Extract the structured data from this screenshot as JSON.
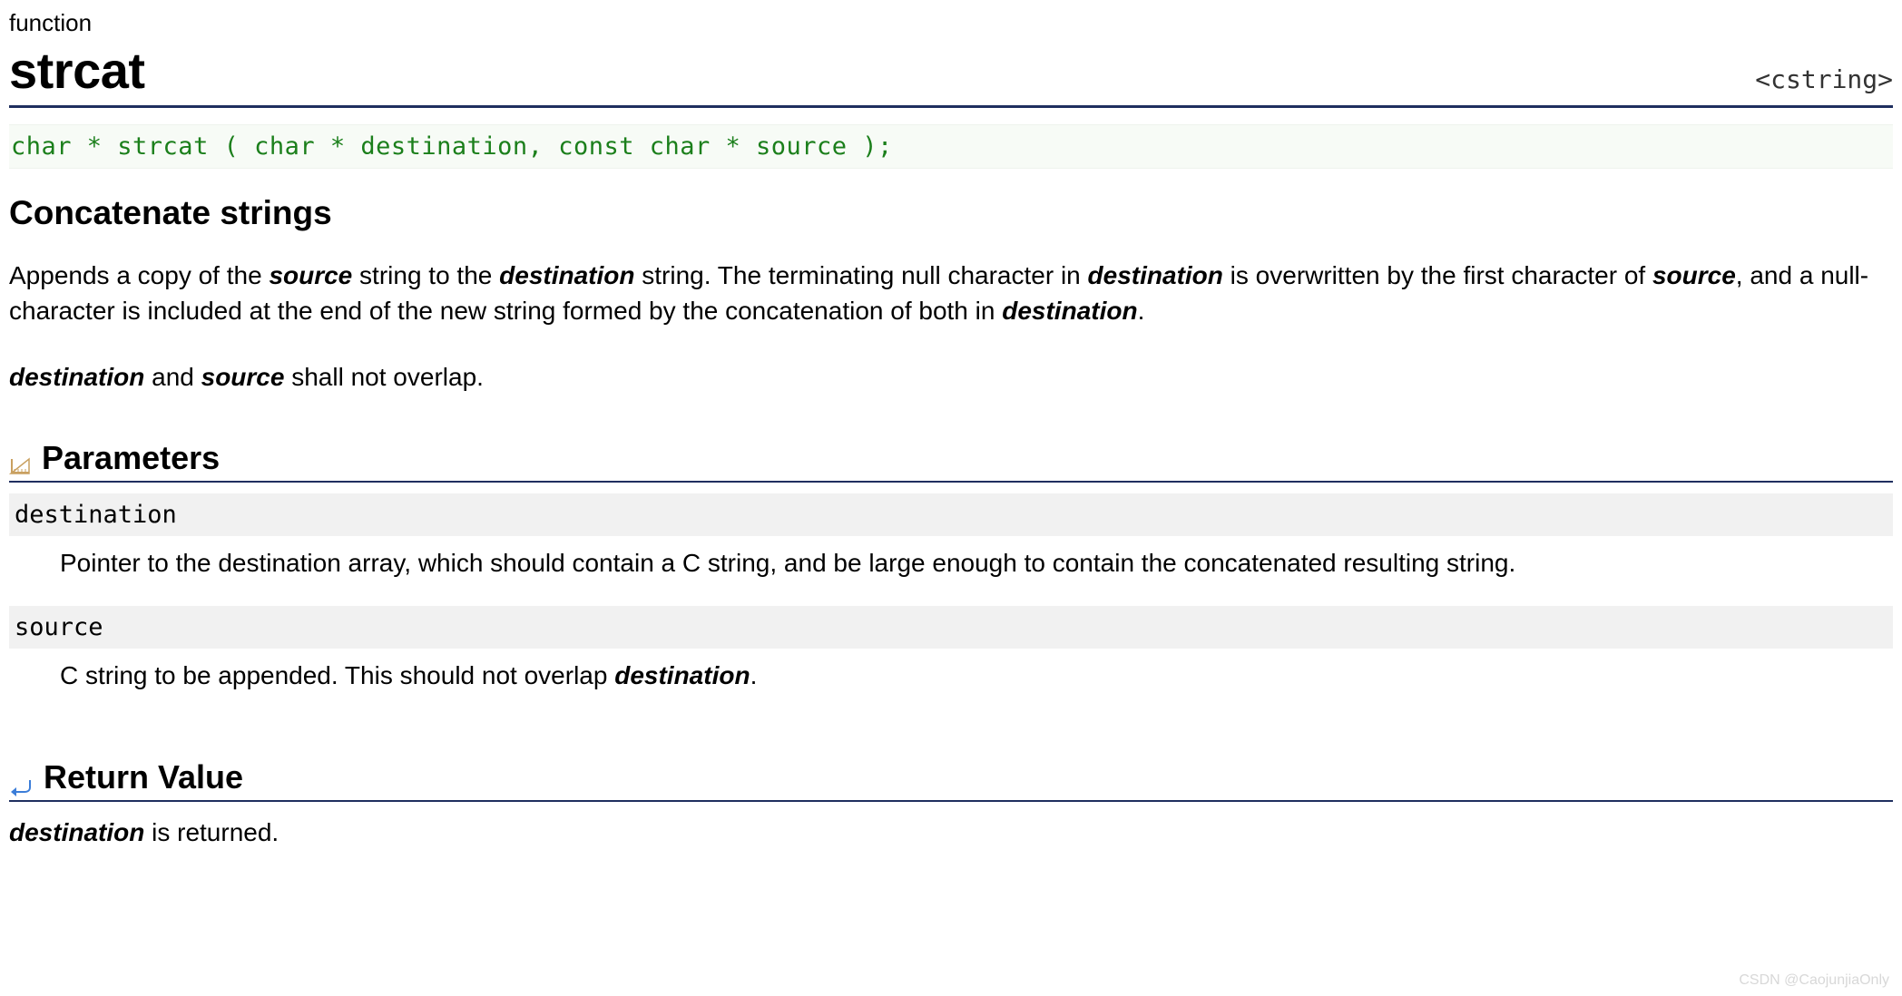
{
  "header": {
    "category": "function",
    "title": "strcat",
    "include": "<cstring>"
  },
  "signature": "char * strcat ( char * destination, const char * source );",
  "summary_heading": "Concatenate strings",
  "description": {
    "p1_parts": [
      {
        "t": "Appends a copy of the ",
        "e": false
      },
      {
        "t": "source",
        "e": true
      },
      {
        "t": " string to the ",
        "e": false
      },
      {
        "t": "destination",
        "e": true
      },
      {
        "t": " string. The terminating null character in ",
        "e": false
      },
      {
        "t": "destination",
        "e": true
      },
      {
        "t": " is overwritten by the first character of ",
        "e": false
      },
      {
        "t": "source",
        "e": true
      },
      {
        "t": ", and a null-character is included at the end of the new string formed by the concatenation of both in ",
        "e": false
      },
      {
        "t": "destination",
        "e": true
      },
      {
        "t": ".",
        "e": false
      }
    ],
    "p2_parts": [
      {
        "t": "destination",
        "e": true
      },
      {
        "t": " and ",
        "e": false
      },
      {
        "t": "source",
        "e": true
      },
      {
        "t": " shall not overlap.",
        "e": false
      }
    ]
  },
  "sections": {
    "parameters": {
      "heading": "Parameters",
      "items": [
        {
          "name": "destination",
          "desc_parts": [
            {
              "t": "Pointer to the destination array, which should contain a C string, and be large enough to contain the concatenated resulting string.",
              "e": false
            }
          ]
        },
        {
          "name": "source",
          "desc_parts": [
            {
              "t": "C string to be appended. This should not overlap ",
              "e": false
            },
            {
              "t": "destination",
              "e": true
            },
            {
              "t": ".",
              "e": false
            }
          ]
        }
      ]
    },
    "return_value": {
      "heading": "Return Value",
      "desc_parts": [
        {
          "t": "destination",
          "e": true
        },
        {
          "t": " is returned.",
          "e": false
        }
      ]
    }
  },
  "watermark": "CSDN @CaojunjiaOnly"
}
